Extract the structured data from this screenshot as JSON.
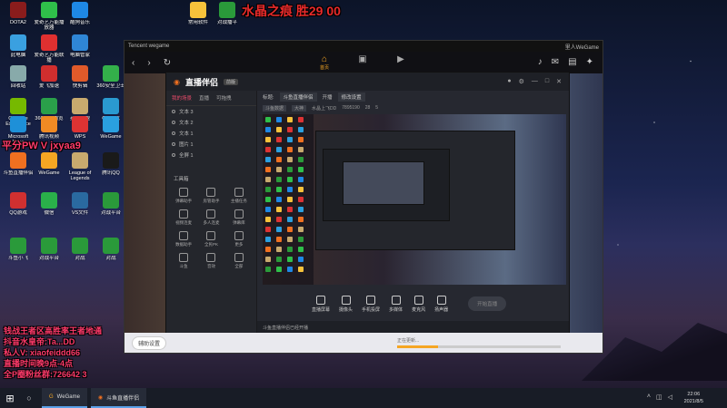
{
  "desktop": {
    "icons": [
      {
        "label": "DOTA2",
        "color": "#8a1c1c"
      },
      {
        "label": "爱奇艺万能播放器",
        "color": "#2fbf4a"
      },
      {
        "label": "酷狗音乐",
        "color": "#1e88e5"
      },
      {
        "label": "常用软件",
        "color": "#f7c23b"
      },
      {
        "label": "对战播平",
        "color": "#2a9a3a"
      },
      {
        "label": "此电脑",
        "color": "#3aa0e0"
      },
      {
        "label": "爱奇艺万能联播",
        "color": "#e03030"
      },
      {
        "label": "电脑管家",
        "color": "#2f86d6"
      },
      {
        "label": "回收站",
        "color": "#8aa"
      },
      {
        "label": "爱飞加速",
        "color": "#d12e2e"
      },
      {
        "label": "快剪辑",
        "color": "#e05a2a"
      },
      {
        "label": "360安全卫士",
        "color": "#33b04a"
      },
      {
        "label": "GeForce Experience",
        "color": "#76b900"
      },
      {
        "label": "360安全浏览器",
        "color": "#2aa04a"
      },
      {
        "label": "英雄联盟",
        "color": "#c8aa6e"
      },
      {
        "label": "QQ游戏",
        "color": "#2a9ad0"
      },
      {
        "label": "Microsoft Edge",
        "color": "#1e90d8"
      },
      {
        "label": "腾讯视频",
        "color": "#f08a24"
      },
      {
        "label": "WPS",
        "color": "#d33"
      },
      {
        "label": "WeGame",
        "color": "#2aa0e0"
      },
      {
        "label": "斗鱼直播伴侣",
        "color": "#f07020"
      },
      {
        "label": "WeGame",
        "color": "#f5a623"
      },
      {
        "label": "League of Legends",
        "color": "#c8aa6e"
      },
      {
        "label": "腾讯QQ",
        "color": "#1a1a1a"
      },
      {
        "label": "QQ游戏",
        "color": "#d03030"
      },
      {
        "label": "微信",
        "color": "#2ab04a"
      },
      {
        "label": "VS文件",
        "color": "#2a6aa0"
      },
      {
        "label": "对战平台",
        "color": "#2a9a3a"
      },
      {
        "label": "斗鱼小飞",
        "color": "#2a9a3a"
      },
      {
        "label": "对战平台",
        "color": "#2a9a3a"
      },
      {
        "label": "对战",
        "color": "#2a9a3a"
      },
      {
        "label": "对战",
        "color": "#2a9a3a"
      }
    ]
  },
  "overlay": {
    "title": "水晶之痕 胜29 00",
    "left_top": "平分PW V jxyaa9",
    "left_bottom": [
      "钱战王者区高胜率王者地通",
      "抖音水皇帝:Ta...DD",
      "私人V: xiaofeiddd66",
      "直播时间晚9点-4点",
      "全P圈粉丝群:726642 3"
    ]
  },
  "wegame": {
    "brand": "Tencent wegame",
    "user": "里人WeGame",
    "home_label": "首页",
    "assist_button": "辅助设置",
    "progress_text": "正在更新...",
    "progress_value": 0.25
  },
  "companion": {
    "logo": "直播伴侣",
    "version_badge": "前版",
    "side_tabs": [
      "我的场景",
      "直播",
      "可拖拽"
    ],
    "layers": [
      "文本 3",
      "文本 2",
      "文本 1",
      "图片 1",
      "全屏 1"
    ],
    "tools_title": "工具箱",
    "tools": [
      "弹幕助手",
      "房管助手",
      "主播任务",
      "视频连麦",
      "多人连麦",
      "弹幕库",
      "数据助手",
      "全民PK",
      "更多",
      "斗鱼",
      "音效",
      "全部"
    ],
    "top_fields": [
      "标题:",
      "斗鱼直播伴侣",
      "开播",
      "修改设置"
    ],
    "stats": [
      "斗鱼数据",
      "大神",
      "水晶上飞DD",
      "7895190",
      "28",
      "5"
    ],
    "bottom_buttons": [
      "直播屏幕",
      "摄像头",
      "手机投屏",
      "多媒体",
      "麦克风",
      "扬声器"
    ],
    "start_live": "开始直播",
    "footer": "斗鱼直播伴侣已经开播"
  },
  "taskbar": {
    "apps": [
      "WeGame",
      "斗鱼直播伴侣"
    ],
    "time": "22:06",
    "date": "2021/8/5"
  }
}
